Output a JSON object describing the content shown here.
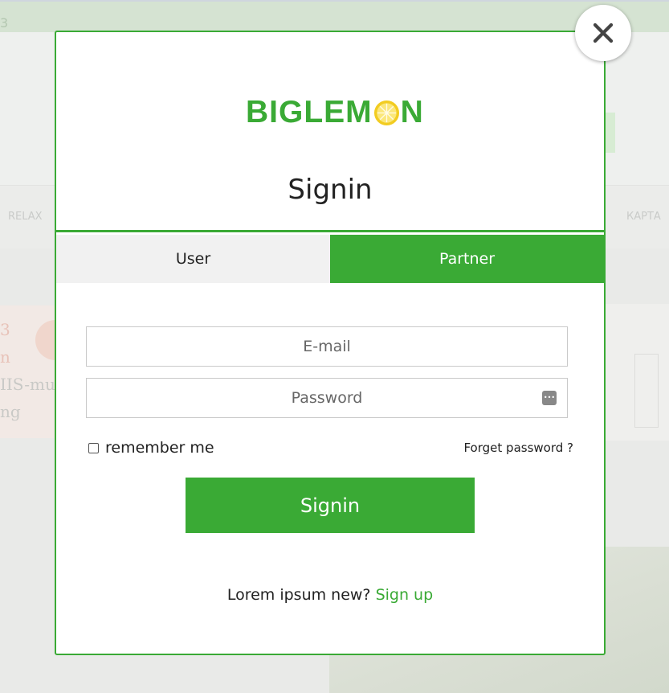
{
  "background": {
    "topbar_num": "3",
    "nav_left": "RELAX",
    "nav_right": "КАРТА",
    "promo_lines": [
      "3",
      "n",
      "IIS-mul",
      "ng"
    ]
  },
  "modal": {
    "brand": {
      "logo_before": "BIGLEM",
      "logo_after": "N",
      "accent_color": "#3aaa35"
    },
    "title": "Signin",
    "tabs": [
      {
        "label": "User",
        "active": false
      },
      {
        "label": "Partner",
        "active": true
      }
    ],
    "form": {
      "email_placeholder": "E-mail",
      "password_placeholder": "Password",
      "password_icon": "password-manager-icon",
      "remember_label": "remember me",
      "remember_checked": false,
      "forget_label": "Forget password ?",
      "submit_label": "Signin"
    },
    "footer": {
      "prompt": "Lorem ipsum new?",
      "signup_label": "Sign up"
    },
    "close_icon": "close-icon"
  }
}
